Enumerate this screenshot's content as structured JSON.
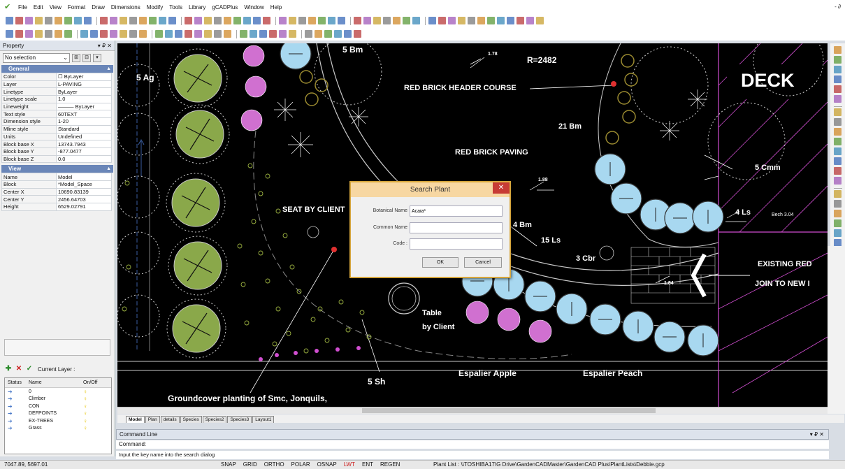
{
  "menu": {
    "items": [
      "File",
      "Edit",
      "View",
      "Format",
      "Draw",
      "Dimensions",
      "Modify",
      "Tools",
      "Library",
      "gCADPlus",
      "Window",
      "Help"
    ],
    "window_controls": "- ∂"
  },
  "property_panel": {
    "title": "Property",
    "title_controls": "▾ ₽ ✕",
    "selection": "No selection",
    "general_header": "General",
    "general": [
      {
        "k": "Color",
        "v": "☐ ByLayer"
      },
      {
        "k": "Layer",
        "v": "L-PAVING"
      },
      {
        "k": "Linetype",
        "v": "ByLayer"
      },
      {
        "k": "Linetype scale",
        "v": "1.0"
      },
      {
        "k": "Lineweight",
        "v": "——— ByLayer"
      },
      {
        "k": "Text style",
        "v": "60TEXT"
      },
      {
        "k": "Dimension style",
        "v": "1-20"
      },
      {
        "k": "Mline style",
        "v": "Standard"
      },
      {
        "k": "Units",
        "v": "Undefined"
      },
      {
        "k": "Block base X",
        "v": "13743.7943"
      },
      {
        "k": "Block base Y",
        "v": "-877.0477"
      },
      {
        "k": "Block base Z",
        "v": "0.0"
      }
    ],
    "view_header": "View",
    "view": [
      {
        "k": "Name",
        "v": "Model"
      },
      {
        "k": "Block",
        "v": "*Model_Space"
      },
      {
        "k": "Center X",
        "v": "10690.83139"
      },
      {
        "k": "Center Y",
        "v": "2456.64703"
      },
      {
        "k": "Height",
        "v": "6529.02791"
      }
    ]
  },
  "layers": {
    "current_layer_label": "Current Layer :",
    "columns": [
      "Status",
      "Name",
      "On/Off"
    ],
    "rows": [
      "0",
      "Climber",
      "CON",
      "DEFPOINTS",
      "EX-TREES",
      "Grass"
    ]
  },
  "drawing_labels": {
    "bm5": "5 Bm",
    "ag5": "5 Ag",
    "dim178": "1.78",
    "radius": "R=2482",
    "deck": "DECK",
    "header_course": "RED BRICK HEADER COURSE",
    "bm21": "21 Bm",
    "paving": "RED BRICK PAVING",
    "cmm5": "5 Cmm",
    "dim188": "1.88",
    "ls4": "4 Ls",
    "bench": "Bech 3.04",
    "seat": "SEAT BY CLIENT",
    "bm4": "4 Bm",
    "ls15": "15 Ls",
    "cbr3": "3 Cbr",
    "existing": "EXISTING RED",
    "join": "JOIN TO NEW I",
    "dim184": "1.84",
    "table": "Table",
    "byclient": "by Client",
    "sh5": "5 Sh",
    "espalier_apple": "Espalier Apple",
    "espalier_peach": "Espalier Peach",
    "groundcover": "Groundcover planting of Smc, Jonquils,"
  },
  "tabs": [
    "Model",
    "Plan",
    "details",
    "Species",
    "Species2",
    "Species3",
    "Layout1"
  ],
  "command": {
    "title": "Command Line",
    "title_controls": "▾ ₽ ✕",
    "prompt": "Command:",
    "hint": "Input the key name into the search dialog"
  },
  "status": {
    "coords": "7047.89,  5697.01",
    "modes": [
      "SNAP",
      "GRID",
      "ORTHO",
      "POLAR",
      "OSNAP",
      "LWT",
      "ENT",
      "REGEN"
    ],
    "active_mode": "LWT",
    "plant_list": "Plant List : \\\\TOSHIBA17\\G Drive\\GardenCADMaster\\GardenCAD Plus\\PlantLists\\Debbie.gcp"
  },
  "dialog": {
    "title": "Search Plant",
    "close": "✕",
    "botanical_label": "Botanical Name",
    "botanical_value": "Acaia*",
    "common_label": "Common Name",
    "common_value": "",
    "code_label": "Code :",
    "code_value": "",
    "ok": "OK",
    "cancel": "Cancel"
  },
  "colors": {
    "canvas": "#000000",
    "paving_line": "#c8c8c8",
    "magenta": "#d04ed0",
    "blue_plant": "#a8d8f0",
    "green_plant": "#8aa84a"
  }
}
